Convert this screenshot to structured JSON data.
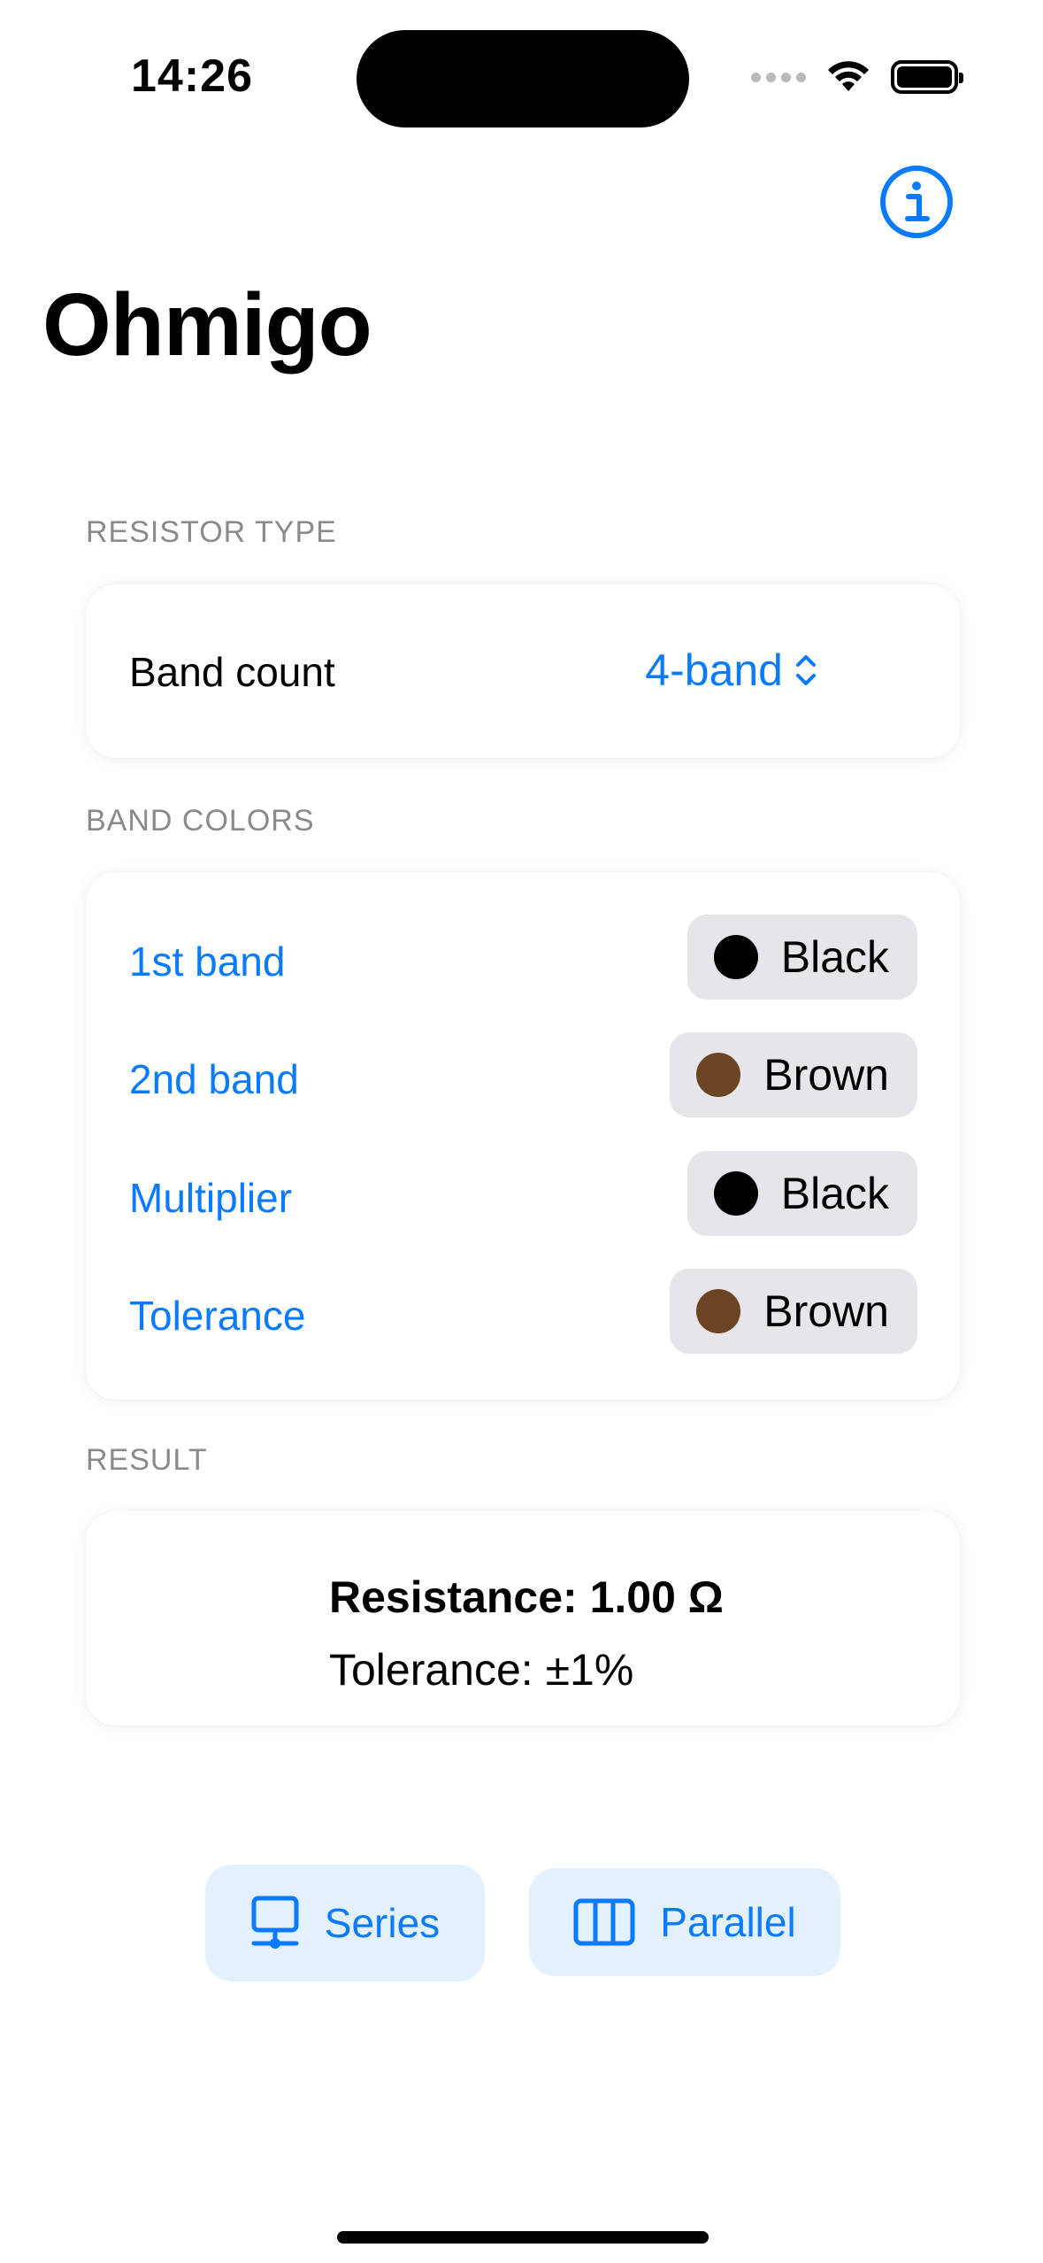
{
  "status_bar": {
    "time": "14:26"
  },
  "app": {
    "title": "Ohmigo"
  },
  "resistor_type": {
    "header": "RESISTOR TYPE",
    "band_count_label": "Band count",
    "band_count_value": "4-band"
  },
  "band_colors": {
    "header": "BAND COLORS",
    "rows": [
      {
        "label": "1st band",
        "color_name": "Black",
        "swatch": "#000000"
      },
      {
        "label": "2nd band",
        "color_name": "Brown",
        "swatch": "#6b4423"
      },
      {
        "label": "Multiplier",
        "color_name": "Black",
        "swatch": "#000000"
      },
      {
        "label": "Tolerance",
        "color_name": "Brown",
        "swatch": "#6b4423"
      }
    ]
  },
  "result": {
    "header": "RESULT",
    "resistance": "Resistance: 1.00 Ω",
    "tolerance": "Tolerance: ±1%"
  },
  "actions": {
    "series_label": "Series",
    "parallel_label": "Parallel"
  },
  "colors": {
    "accent": "#0a7aff",
    "chip_bg": "#e5e5ea",
    "action_bg": "#e3f0fd"
  }
}
